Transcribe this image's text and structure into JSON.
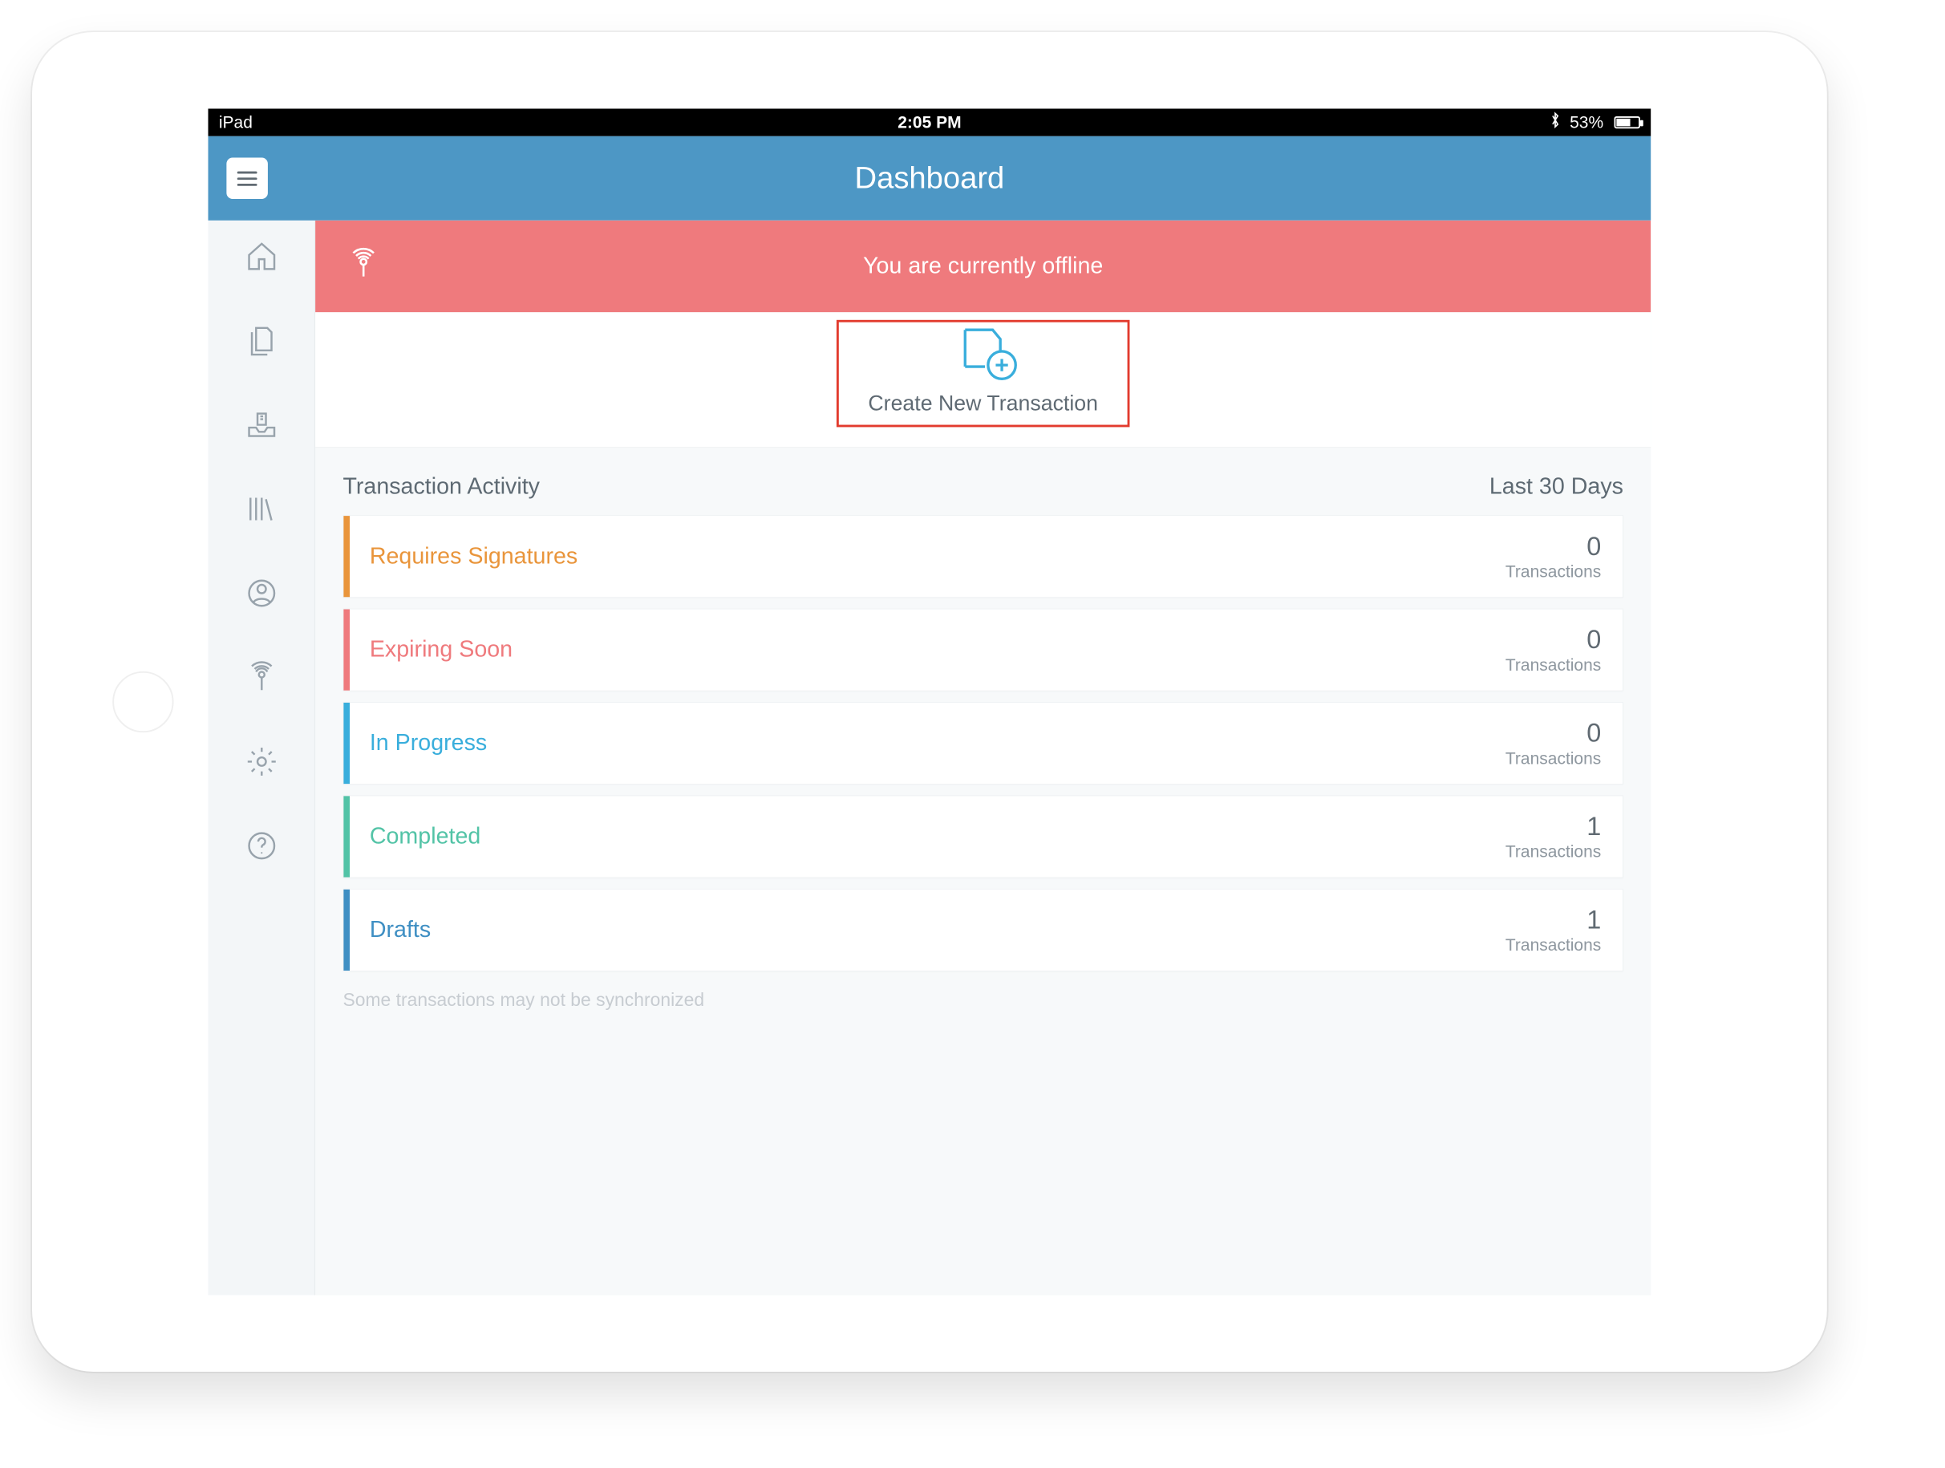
{
  "status_bar": {
    "device": "iPad",
    "time": "2:05 PM",
    "bluetooth": "᛭",
    "battery_pct": "53%"
  },
  "header": {
    "title": "Dashboard"
  },
  "banner": {
    "text": "You are currently offline"
  },
  "create": {
    "label": "Create New Transaction"
  },
  "activity": {
    "title": "Transaction Activity",
    "range": "Last 30 Days",
    "unit": "Transactions",
    "rows": [
      {
        "label": "Requires Signatures",
        "count": "0",
        "color": "#e9953b"
      },
      {
        "label": "Expiring Soon",
        "count": "0",
        "color": "#ef7a7d"
      },
      {
        "label": "In Progress",
        "count": "0",
        "color": "#39aedc"
      },
      {
        "label": "Completed",
        "count": "1",
        "color": "#52c3a6"
      },
      {
        "label": "Drafts",
        "count": "1",
        "color": "#3f8fc3"
      }
    ]
  },
  "footer": {
    "note": "Some transactions may not be synchronized"
  },
  "sidebar": {
    "items": [
      {
        "name": "home"
      },
      {
        "name": "documents"
      },
      {
        "name": "inbox"
      },
      {
        "name": "library"
      },
      {
        "name": "profile"
      },
      {
        "name": "offline"
      },
      {
        "name": "settings"
      },
      {
        "name": "help"
      }
    ]
  }
}
